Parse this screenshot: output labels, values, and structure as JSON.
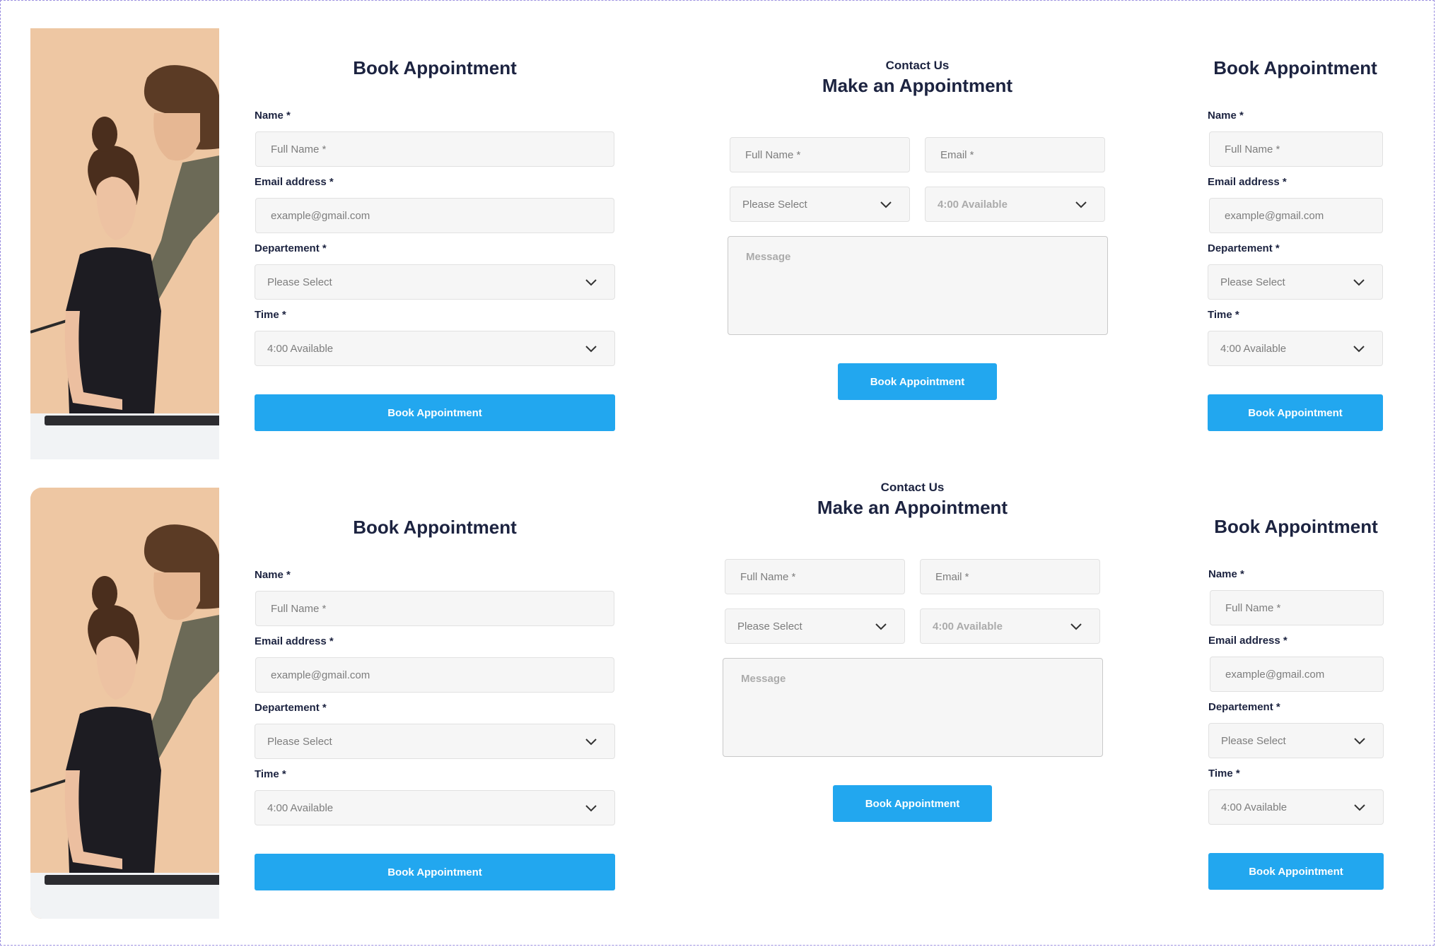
{
  "book_form": {
    "title": "Book Appointment",
    "name_label": "Name *",
    "name_placeholder": "Full Name *",
    "email_label": "Email address *",
    "email_placeholder": "example@gmail.com",
    "department_label": "Departement *",
    "department_value": "Please Select",
    "time_label": "Time *",
    "time_value": "4:00 Available",
    "submit_label": "Book Appointment"
  },
  "contact_form": {
    "eyebrow": "Contact Us",
    "title": "Make an Appointment",
    "name_placeholder": "Full Name *",
    "email_placeholder": "Email *",
    "department_value": "Please Select",
    "time_value": "4:00 Available",
    "message_placeholder": "Message",
    "submit_label": "Book Appointment"
  },
  "colors": {
    "accent": "#22a7ef",
    "heading": "#1c2340",
    "field_bg": "#f6f6f6",
    "photo_bg": "#ecc7a4"
  },
  "icons": [
    "chevron-down-icon"
  ]
}
